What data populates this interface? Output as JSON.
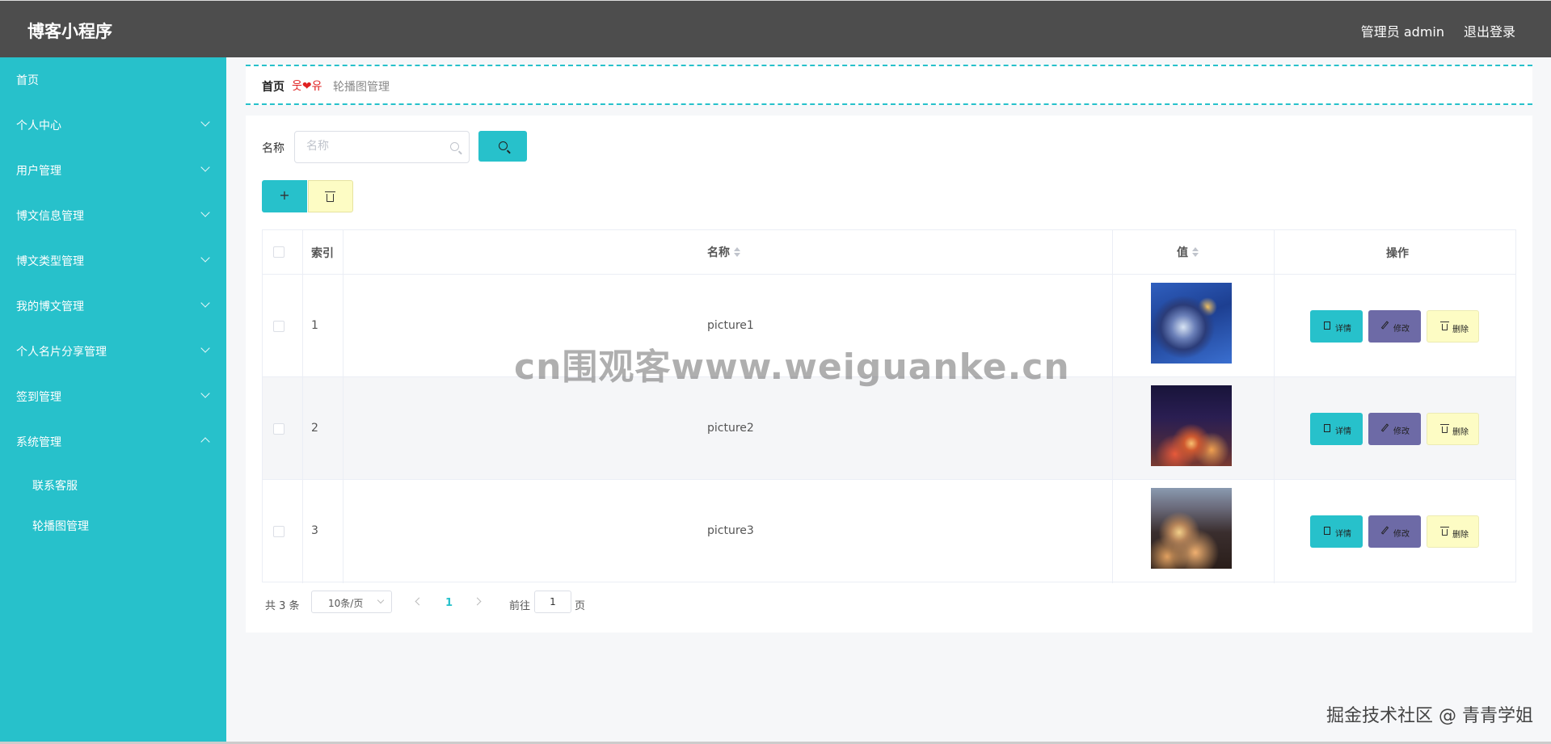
{
  "header": {
    "title": "博客小程序",
    "admin_label": "管理员 admin",
    "logout": "退出登录"
  },
  "sidebar": {
    "items": [
      {
        "label": "首页"
      },
      {
        "label": "个人中心"
      },
      {
        "label": "用户管理"
      },
      {
        "label": "博文信息管理"
      },
      {
        "label": "博文类型管理"
      },
      {
        "label": "我的博文管理"
      },
      {
        "label": "个人名片分享管理"
      },
      {
        "label": "签到管理"
      },
      {
        "label": "系统管理"
      }
    ],
    "sub_items": [
      {
        "label": "联系客服"
      },
      {
        "label": "轮播图管理"
      }
    ]
  },
  "breadcrumb": {
    "home": "首页",
    "separator": "웃❤유",
    "current": "轮播图管理"
  },
  "search": {
    "label": "名称",
    "placeholder": "名称"
  },
  "table": {
    "headers": {
      "index": "索引",
      "name": "名称",
      "value": "值",
      "actions": "操作"
    },
    "rows": [
      {
        "index": "1",
        "name": "picture1",
        "image": "city-tower-blue-sky"
      },
      {
        "index": "2",
        "name": "picture2",
        "image": "city-night-skyline"
      },
      {
        "index": "3",
        "name": "picture3",
        "image": "city-tower-dusk"
      }
    ],
    "actions": {
      "view": "详情",
      "edit": "修改",
      "delete": "删除"
    }
  },
  "pagination": {
    "total": "共 3 条",
    "page_size": "10条/页",
    "current_page": "1",
    "goto_prefix": "前往",
    "goto_value": "1",
    "goto_suffix": "页"
  },
  "overlay": {
    "watermark": "cn围观客www.weiguanke.cn",
    "credit": "掘金技术社区 @ 青青学姐"
  },
  "colors": {
    "accent": "#27c1cb",
    "header": "#4d4d4d",
    "edit": "#6d6aa6",
    "delete": "#fdfcc4"
  }
}
